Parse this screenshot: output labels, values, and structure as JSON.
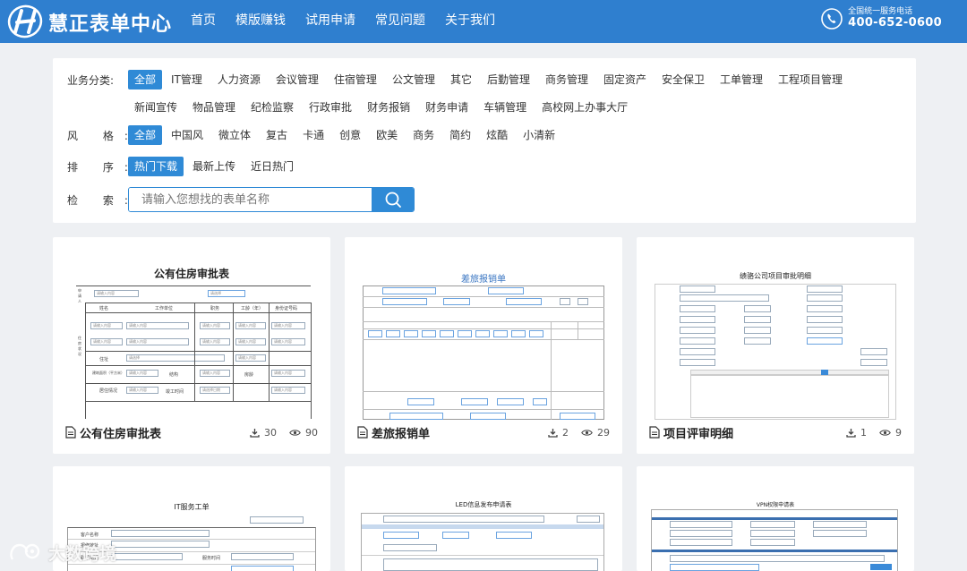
{
  "header": {
    "brand": "慧正表单中心",
    "nav": [
      "首页",
      "模版赚钱",
      "试用申请",
      "常见问题",
      "关于我们"
    ],
    "phone_label": "全国统一服务电话",
    "phone_number": "400-652-0600",
    "color": "#2f7fcf"
  },
  "filters": {
    "category": {
      "label": "业务分类:",
      "row1": [
        "全部",
        "IT管理",
        "人力资源",
        "会议管理",
        "住宿管理",
        "公文管理",
        "其它",
        "后勤管理",
        "商务管理",
        "固定资产",
        "安全保卫",
        "工单管理",
        "工程项目管理"
      ],
      "row2": [
        "新闻宣传",
        "物品管理",
        "纪检监察",
        "行政审批",
        "财务报销",
        "财务申请",
        "车辆管理",
        "高校网上办事大厅"
      ]
    },
    "style": {
      "label": "风 格:",
      "options": [
        "全部",
        "中国风",
        "微立体",
        "复古",
        "卡通",
        "创意",
        "欧美",
        "商务",
        "简约",
        "炫酷",
        "小清新"
      ]
    },
    "sort": {
      "label": "排 序:",
      "options": [
        "热门下载",
        "最新上传",
        "近日热门"
      ]
    },
    "search": {
      "label": "检 索:",
      "placeholder": "请输入您想找的表单名称"
    },
    "accent": "#2f8ad6"
  },
  "cards": [
    {
      "title": "公有住房审批表",
      "downloads": "30",
      "views": "90",
      "thumb_title": "公有住房审批表"
    },
    {
      "title": "差旅报销单",
      "downloads": "2",
      "views": "29",
      "thumb_title": "差旅报销单"
    },
    {
      "title": "项目评审明细",
      "downloads": "1",
      "views": "9",
      "thumb_title": "绩骆公司项目审批明细"
    },
    {
      "title": "",
      "downloads": "",
      "views": "",
      "thumb_title": "IT服务工单"
    },
    {
      "title": "",
      "downloads": "",
      "views": "",
      "thumb_title": "LED信息发布申请表"
    },
    {
      "title": "",
      "downloads": "",
      "views": "",
      "thumb_title": "VPN权限申请表"
    }
  ],
  "thumb_text": {
    "c1_placeholder": "请输入内容",
    "c1_headers": [
      "姓名",
      "工作单位",
      "职务",
      "工龄（年）",
      "身份证号码"
    ],
    "c1_rows": [
      "住址",
      "建筑面积（平方米）",
      "结构",
      "房龄",
      "居住情况"
    ],
    "c1_extra": [
      "请选择",
      "建筑层数",
      "竣工时间",
      "请选择日期"
    ],
    "c4_labels": [
      "客户名称",
      "报修地址",
      "联系电话",
      "服务时间"
    ]
  },
  "watermark": "大数跨境"
}
